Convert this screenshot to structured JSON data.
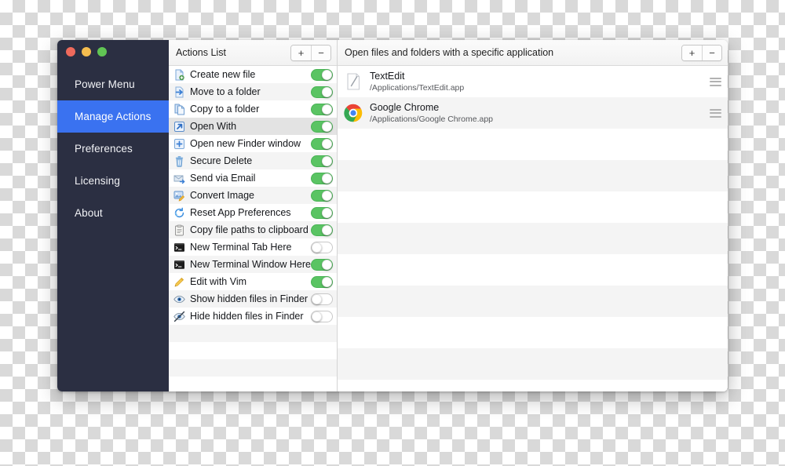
{
  "window": {
    "traffic_lights": [
      "close",
      "minimize",
      "maximize"
    ],
    "colors": {
      "sidebar_bg": "#2b2f42",
      "accent": "#3a72f0",
      "toggle_on": "#5ac463",
      "close": "#ef6a5c",
      "minimize": "#f5bd4f",
      "maximize": "#61c554"
    }
  },
  "sidebar": {
    "items": [
      {
        "label": "Power Menu",
        "active": false
      },
      {
        "label": "Manage Actions",
        "active": true
      },
      {
        "label": "Preferences",
        "active": false
      },
      {
        "label": "Licensing",
        "active": false
      },
      {
        "label": "About",
        "active": false
      }
    ]
  },
  "actions_panel": {
    "header": {
      "title": "Actions List",
      "add_label": "+",
      "remove_label": "−"
    },
    "rows": [
      {
        "label": "Create new file",
        "icon": "new-file-icon",
        "enabled": true,
        "selected": false
      },
      {
        "label": "Move to a folder",
        "icon": "move-arrow-icon",
        "enabled": true,
        "selected": false
      },
      {
        "label": "Copy to a folder",
        "icon": "copy-file-icon",
        "enabled": true,
        "selected": false
      },
      {
        "label": "Open With",
        "icon": "open-with-arrow-icon",
        "enabled": true,
        "selected": true
      },
      {
        "label": "Open new Finder window",
        "icon": "new-window-icon",
        "enabled": true,
        "selected": false
      },
      {
        "label": "Secure Delete",
        "icon": "trash-icon",
        "enabled": true,
        "selected": false
      },
      {
        "label": "Send via Email",
        "icon": "envelope-icon",
        "enabled": true,
        "selected": false
      },
      {
        "label": "Convert Image",
        "icon": "convert-image-icon",
        "enabled": true,
        "selected": false
      },
      {
        "label": "Reset App Preferences",
        "icon": "refresh-circle-icon",
        "enabled": true,
        "selected": false
      },
      {
        "label": "Copy file paths to clipboard",
        "icon": "clipboard-icon",
        "enabled": true,
        "selected": false
      },
      {
        "label": "New Terminal Tab Here",
        "icon": "terminal-icon",
        "enabled": false,
        "selected": false
      },
      {
        "label": "New Terminal Window Here",
        "icon": "terminal-icon",
        "enabled": true,
        "selected": false
      },
      {
        "label": "Edit with Vim",
        "icon": "pencil-icon",
        "enabled": true,
        "selected": false
      },
      {
        "label": "Show hidden files in Finder",
        "icon": "eye-icon",
        "enabled": false,
        "selected": false
      },
      {
        "label": "Hide hidden files in Finder",
        "icon": "eye-slash-icon",
        "enabled": false,
        "selected": false
      }
    ]
  },
  "detail_panel": {
    "header": {
      "title": "Open files and folders with a specific application",
      "add_label": "+",
      "remove_label": "−"
    },
    "rows": [
      {
        "name": "TextEdit",
        "path": "/Applications/TextEdit.app",
        "icon": "textedit-icon"
      },
      {
        "name": "Google Chrome",
        "path": "/Applications/Google Chrome.app",
        "icon": "chrome-icon"
      }
    ]
  }
}
